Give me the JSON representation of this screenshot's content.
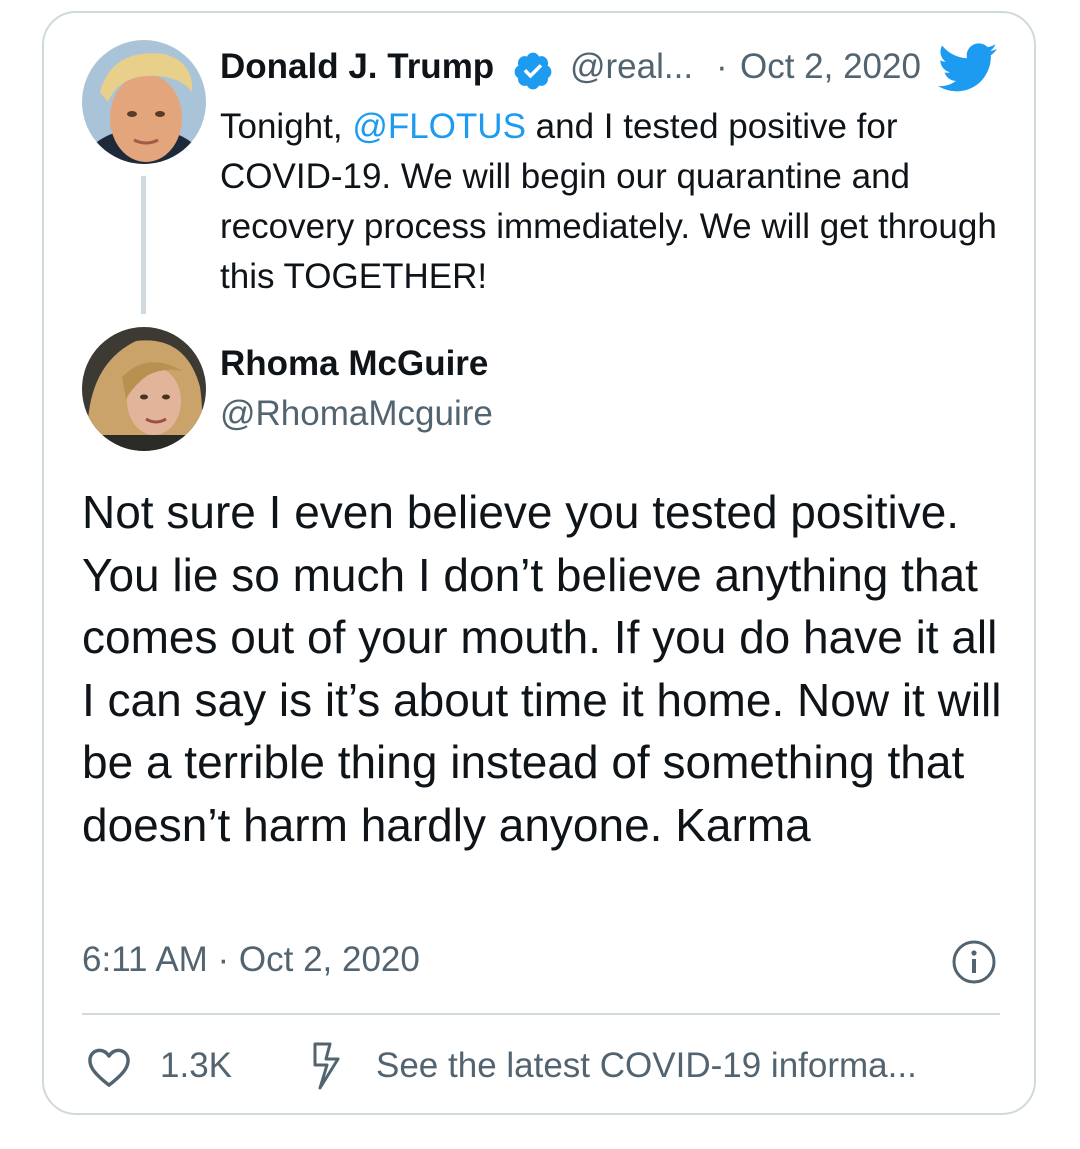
{
  "quoted_tweet": {
    "author_name": "Donald J. Trump",
    "handle": "@real...",
    "separator": "·",
    "date": "Oct 2, 2020",
    "text_before": "Tonight, ",
    "mention": "@FLOTUS",
    "text_after": " and I tested positive for COVID-19. We will begin our quarantine and recovery process immediately. We will get through this TOGETHER!",
    "verified_icon": "verified-badge-icon",
    "logo_icon": "twitter-bird-icon"
  },
  "reply": {
    "author_name": "Rhoma McGuire",
    "handle": "@RhomaMcguire",
    "text": "Not sure I even believe you tested positive. You lie so much I don’t believe anything that comes out of your mouth. If you do have it all I can say is it’s about time it home. Now it will be a terrible thing instead of something that doesn’t harm hardly anyone. Karma",
    "timestamp": "6:11 AM · Oct 2, 2020",
    "info_icon": "info-icon"
  },
  "footer": {
    "like_icon": "heart-icon",
    "like_count": "1.3K",
    "covid_icon": "lightning-icon",
    "covid_link": "See the latest COVID-19 informa..."
  },
  "colors": {
    "accent": "#1d9bf0",
    "muted": "#536471",
    "border": "#cfd9de"
  }
}
